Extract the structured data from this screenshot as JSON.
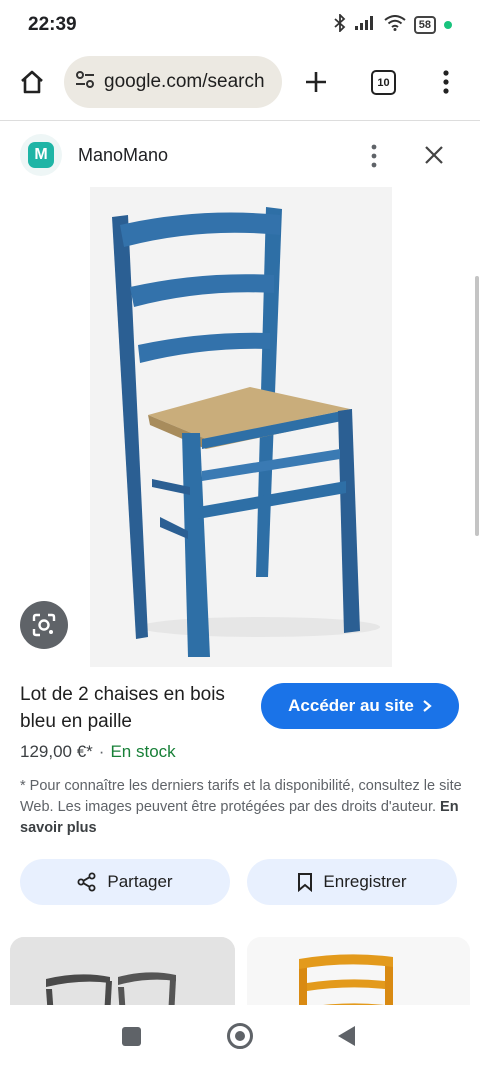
{
  "status_bar": {
    "time": "22:39",
    "battery": "58",
    "icons": [
      "bluetooth-icon",
      "signal-icon",
      "wifi-icon",
      "battery-icon"
    ]
  },
  "browser": {
    "url": "google.com/search",
    "tab_count": "10"
  },
  "panel": {
    "source_name": "ManoMano",
    "source_logo_letter": "M",
    "product_title": "Lot de 2 chaises en bois bleu en paille",
    "visit_label": "Accéder au site",
    "price": "129,00 €*",
    "separator": "·",
    "stock": "En stock",
    "disclaimer": "* Pour connaître les derniers tarifs et la disponibilité, consultez le site Web. Les images peuvent être protégées par des droits d'auteur.",
    "learn_more": "En savoir plus",
    "share_label": "Partager",
    "save_label": "Enregistrer"
  },
  "colors": {
    "accent": "#1a73e8",
    "stock_green": "#188038",
    "chair_blue": "#2e6fa6",
    "action_bg": "#e8f0fe"
  }
}
